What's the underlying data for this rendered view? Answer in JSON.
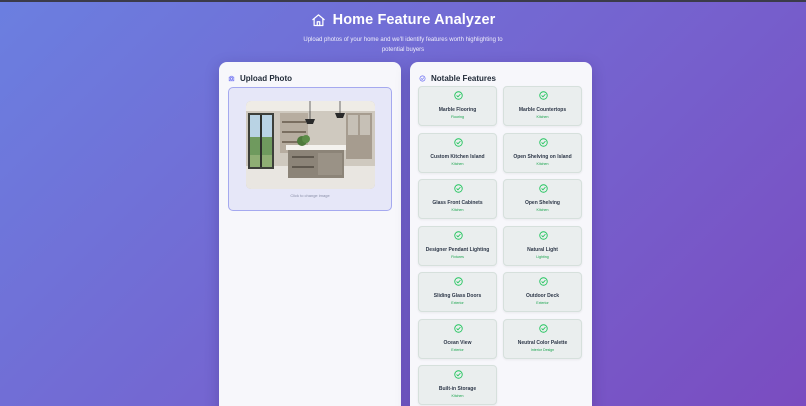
{
  "header": {
    "title": "Home Feature Analyzer",
    "subtitle": "Upload photos of your home and we'll identify features worth highlighting to potential buyers",
    "icon": "house-icon"
  },
  "upload": {
    "title": "Upload Photo",
    "icon": "camera-icon",
    "caption": "Click to change image"
  },
  "features": {
    "title": "Notable Features",
    "icon": "check-circle-icon",
    "items": [
      {
        "name": "Marble Flooring",
        "category": "Flooring"
      },
      {
        "name": "Marble Countertops",
        "category": "Kitchen"
      },
      {
        "name": "Custom Kitchen Island",
        "category": "Kitchen"
      },
      {
        "name": "Open Shelving on Island",
        "category": "Kitchen"
      },
      {
        "name": "Glass Front Cabinets",
        "category": "Kitchen"
      },
      {
        "name": "Open Shelving",
        "category": "Kitchen"
      },
      {
        "name": "Designer Pendant Lighting",
        "category": "Fixtures"
      },
      {
        "name": "Natural Light",
        "category": "Lighting"
      },
      {
        "name": "Sliding Glass Doors",
        "category": "Exterior"
      },
      {
        "name": "Outdoor Deck",
        "category": "Exterior"
      },
      {
        "name": "Ocean View",
        "category": "Exterior"
      },
      {
        "name": "Neutral Color Palette",
        "category": "Interior Design"
      },
      {
        "name": "Built-in Storage",
        "category": "Kitchen"
      }
    ]
  },
  "colors": {
    "accent": "#6366f1",
    "check": "#22c55e",
    "category": "#16a34a"
  }
}
